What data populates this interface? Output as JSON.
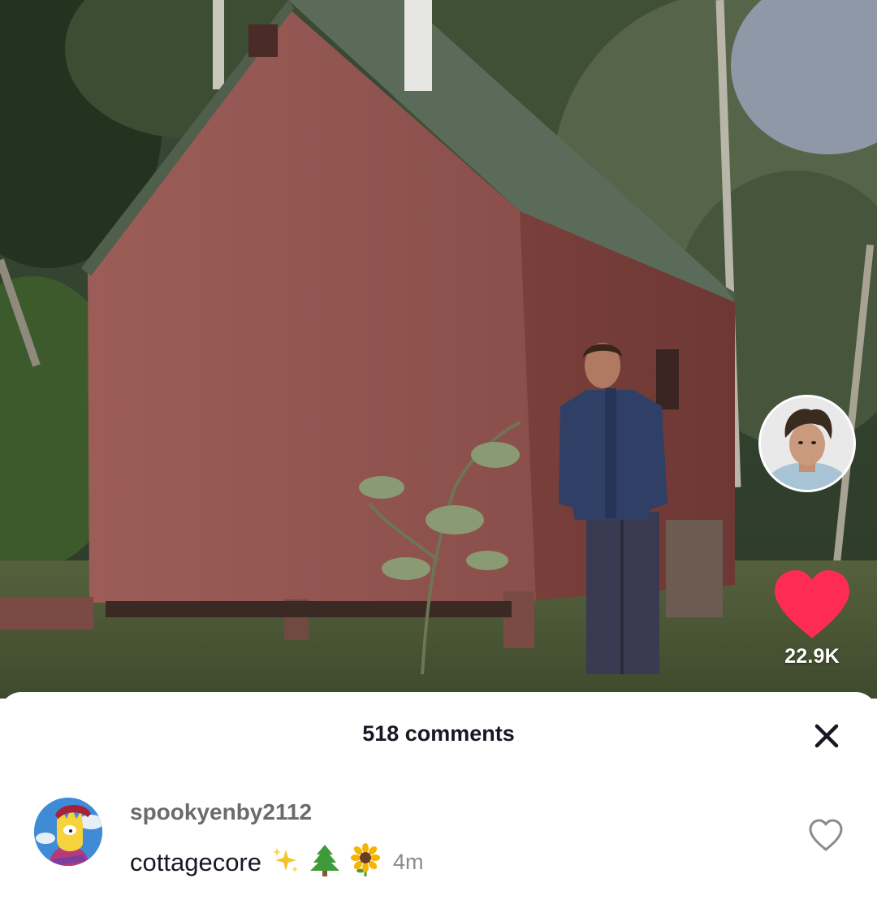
{
  "video": {
    "like_count": "22.9K",
    "like_color": "#fe2c55",
    "icons": {
      "like": "heart-filled-icon",
      "creator": "avatar"
    }
  },
  "comments_sheet": {
    "title": "518 comments",
    "close_icon": "close-x-icon",
    "comments": [
      {
        "username": "spookyenby2112",
        "text": "cottagecore",
        "emojis": [
          "sparkles",
          "evergreen-tree",
          "sunflower"
        ],
        "time": "4m",
        "like_icon": "heart-outline-icon"
      }
    ]
  },
  "colors": {
    "text_primary": "#161823",
    "text_secondary": "#8a8b91",
    "accent": "#fe2c55"
  }
}
